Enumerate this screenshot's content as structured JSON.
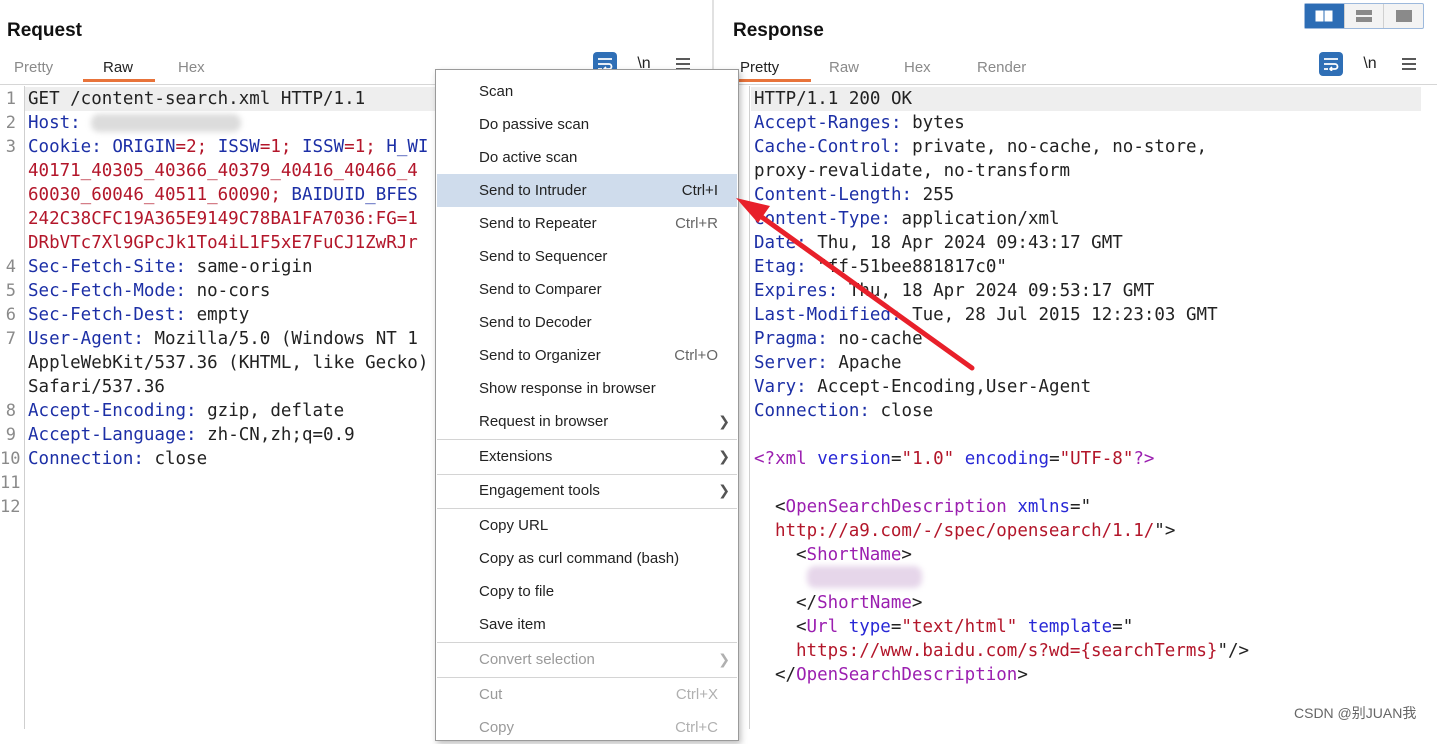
{
  "request": {
    "title": "Request",
    "tabs": [
      "Pretty",
      "Raw",
      "Hex"
    ],
    "active_tab": "Raw",
    "tools": {
      "wrap_icon": "wrap-lines-icon",
      "newline": "\\n",
      "menu_icon": "hamburger-menu-icon"
    },
    "lines": {
      "l1": "GET /content-search.xml HTTP/1.1",
      "l2_name": "Host",
      "l3_name": "Cookie",
      "l3_v1": "ORIGIN",
      "l3_v2": "=2; ",
      "l3_v3": "ISSW",
      "l3_v4": "=1; ",
      "l3_v5": "ISSW",
      "l3_v6": "=1; ",
      "l3_v7": "H_WI",
      "l3b": "40171_40305_40366_40379_40416_40466_4",
      "l3c_a": "60030_60046_40511_60090; ",
      "l3c_b": "BAIDUID_BFES",
      "l3d": "242C38CFC19A365E9149C78BA1FA7036:FG=1",
      "l3e": "DRbVTc7Xl9GPcJk1To4iL1F5xE7FuCJ1ZwRJr",
      "l4_name": "Sec-Fetch-Site",
      "l4_val": "same-origin",
      "l5_name": "Sec-Fetch-Mode",
      "l5_val": "no-cors",
      "l6_name": "Sec-Fetch-Dest",
      "l6_val": "empty",
      "l7_name": "User-Agent",
      "l7_val": "Mozilla/5.0 (Windows NT 1",
      "l7b": "AppleWebKit/537.36 (KHTML, like Gecko)",
      "l7c": "Safari/537.36",
      "l8_name": "Accept-Encoding",
      "l8_val": "gzip, deflate",
      "l9_name": "Accept-Language",
      "l9_val": "zh-CN,zh;q=0.9",
      "l10_name": "Connection",
      "l10_val": "close"
    },
    "line_numbers": [
      "1",
      "2",
      "3",
      "4",
      "5",
      "6",
      "7",
      "8",
      "9",
      "10",
      "11",
      "12"
    ]
  },
  "response": {
    "title": "Response",
    "tabs": [
      "Pretty",
      "Raw",
      "Hex",
      "Render"
    ],
    "active_tab": "Pretty",
    "tools": {
      "wrap_icon": "wrap-lines-icon",
      "newline": "\\n",
      "menu_icon": "hamburger-menu-icon"
    },
    "lines": {
      "l1": "HTTP/1.1 200 OK",
      "l2_name": "Accept-Ranges",
      "l2_val": "bytes",
      "l3_name": "Cache-Control",
      "l3_val": "private, no-cache, no-store,",
      "l3b": "proxy-revalidate, no-transform",
      "l4_name": "Content-Length",
      "l4_val": "255",
      "l5_name": "Content-Type",
      "l5_val": "application/xml",
      "l6_name": "Date",
      "l6_val": "Thu, 18 Apr 2024 09:43:17 GMT",
      "l7_name": "Etag",
      "l7_val": "\"ff-51bee881817c0\"",
      "l8_name": "Expires",
      "l8_val": "Thu, 18 Apr 2024 09:53:17 GMT",
      "l9_name": "Last-Modified",
      "l9_val": "Tue, 28 Jul 2015 12:23:03 GMT",
      "l10_name": "Pragma",
      "l10_val": "no-cache",
      "l11_name": "Server",
      "l11_val": "Apache",
      "l12_name": "Vary",
      "l12_val": "Accept-Encoding,User-Agent",
      "l13_name": "Connection",
      "l13_val": "close",
      "xml_decl_open": "<?xml ",
      "xml_version_attr": "version",
      "xml_version_val": "\"1.0\"",
      "xml_encoding_attr": "encoding",
      "xml_encoding_val": "\"UTF-8\"",
      "xml_decl_close": "?>",
      "osd_open": "<",
      "osd_tag": "OpenSearchDescription",
      "osd_attr": "xmlns",
      "osd_eq": "=\"",
      "osd_url": "http://a9.com/-/spec/opensearch/1.1/",
      "osd_close": "\">",
      "short_open_lt": "<",
      "short_tag": "ShortName",
      "short_open_gt": ">",
      "short_close_lt": "</",
      "short_close_gt": ">",
      "url_lt": "<",
      "url_tag": "Url",
      "url_type_attr": "type",
      "url_type_val": "\"text/html\"",
      "url_template_attr": "template",
      "url_eq": "=\"",
      "url_template_val": "https://www.baidu.com/s?wd={searchTerms}",
      "url_end": "\"/>",
      "osd_end_lt": "</",
      "osd_end_gt": ">"
    }
  },
  "layout_toggle": {
    "icons": [
      "side-by-side-layout-icon",
      "stacked-layout-icon",
      "single-pane-layout-icon"
    ],
    "active": 0
  },
  "context_menu": {
    "items": [
      {
        "label": "Scan",
        "shortcut": "",
        "submenu": false,
        "state": "normal"
      },
      {
        "label": "Do passive scan",
        "shortcut": "",
        "submenu": false,
        "state": "normal"
      },
      {
        "label": "Do active scan",
        "shortcut": "",
        "submenu": false,
        "state": "normal"
      },
      {
        "label": "Send to Intruder",
        "shortcut": "Ctrl+I",
        "submenu": false,
        "state": "selected"
      },
      {
        "label": "Send to Repeater",
        "shortcut": "Ctrl+R",
        "submenu": false,
        "state": "normal"
      },
      {
        "label": "Send to Sequencer",
        "shortcut": "",
        "submenu": false,
        "state": "normal"
      },
      {
        "label": "Send to Comparer",
        "shortcut": "",
        "submenu": false,
        "state": "normal"
      },
      {
        "label": "Send to Decoder",
        "shortcut": "",
        "submenu": false,
        "state": "normal"
      },
      {
        "label": "Send to Organizer",
        "shortcut": "Ctrl+O",
        "submenu": false,
        "state": "normal"
      },
      {
        "label": "Show response in browser",
        "shortcut": "",
        "submenu": false,
        "state": "normal"
      },
      {
        "label": "Request in browser",
        "shortcut": "",
        "submenu": true,
        "state": "normal"
      },
      {
        "label": "Extensions",
        "shortcut": "",
        "submenu": true,
        "state": "normal"
      },
      {
        "label": "Engagement tools",
        "shortcut": "",
        "submenu": true,
        "state": "normal"
      },
      {
        "label": "Copy URL",
        "shortcut": "",
        "submenu": false,
        "state": "normal"
      },
      {
        "label": "Copy as curl command (bash)",
        "shortcut": "",
        "submenu": false,
        "state": "normal"
      },
      {
        "label": "Copy to file",
        "shortcut": "",
        "submenu": false,
        "state": "normal"
      },
      {
        "label": "Save item",
        "shortcut": "",
        "submenu": false,
        "state": "normal"
      },
      {
        "label": "Convert selection",
        "shortcut": "",
        "submenu": true,
        "state": "disabled"
      },
      {
        "label": "Cut",
        "shortcut": "Ctrl+X",
        "submenu": false,
        "state": "disabled"
      },
      {
        "label": "Copy",
        "shortcut": "Ctrl+C",
        "submenu": false,
        "state": "disabled"
      }
    ]
  },
  "annotation": {
    "arrow_color": "#e8202a",
    "arrow_icon": "red-pointer-arrow-icon"
  },
  "watermark": "CSDN @别JUAN我",
  "colors": {
    "header_key": "#1c2fa6",
    "value_red": "#b3162a",
    "xml_tag": "#9b1fb0",
    "selection": "#cfdcec",
    "active_tab_underline": "#e8733a",
    "accent_blue": "#2d6db5"
  }
}
